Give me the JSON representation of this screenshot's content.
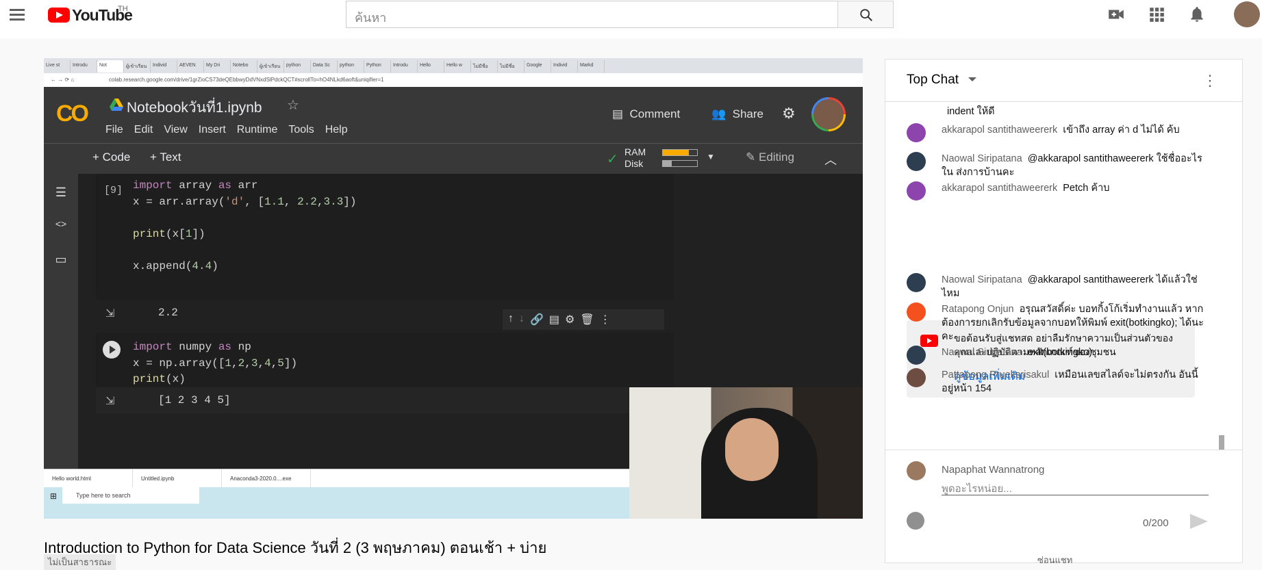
{
  "masthead": {
    "logo_text": "YouTube",
    "country_code": "TH",
    "search_placeholder": "ค้นหา"
  },
  "browser": {
    "tabs": [
      "Live st",
      "Introdu",
      "Not",
      "ผู้เข้าเรียน",
      "Individ",
      "AEVEN",
      "My Dri",
      "Notebo",
      "ผู้เข้าเรียน",
      "python",
      "Data Sc",
      "python",
      "Python",
      "Introdu",
      "Hello",
      "Hello w",
      "ไม่มีชื่อ",
      "ไม่มีชื่อ",
      "Google",
      "Individ",
      "Markd"
    ],
    "url": "colab.research.google.com/drive/1grZioCS73deQEbbwyDdVNxdSlPdckQCT#scrollTo=hO4NLkd6aoft&uniqifier=1"
  },
  "colab": {
    "logo": "CO",
    "notebook_title": "Notebookวันที่1.ipynb",
    "menu": [
      "File",
      "Edit",
      "View",
      "Insert",
      "Runtime",
      "Tools",
      "Help"
    ],
    "comment_label": "Comment",
    "share_label": "Share",
    "add_code": "+ Code",
    "add_text": "+ Text",
    "ram_label": "RAM",
    "disk_label": "Disk",
    "ram_fill": 0.75,
    "disk_fill": 0.25,
    "editing_label": "Editing",
    "cell1": {
      "exec": "[9]",
      "lines": [
        "import array as arr",
        "x = arr.array('d', [1.1, 2.2,3.3])",
        "",
        "print(x[1])",
        "",
        "x.append(4.4)"
      ],
      "output": "2.2"
    },
    "cell2": {
      "lines": [
        "import numpy as np",
        "x = np.array([1,2,3,4,5])",
        "print(x)"
      ],
      "output": "[1 2 3 4 5]"
    }
  },
  "windows": {
    "downloads": [
      "Hello world.html",
      "Untitled.ipynb",
      "Anaconda3-2020.0....exe"
    ],
    "search_placeholder": "Type here to search"
  },
  "video": {
    "title": "Introduction to Python for Data Science วันที่ 2 (3 พฤษภาคม) ตอนเช้า + บ่าย",
    "tag": "ไม่เป็นสาธารณะ"
  },
  "chat": {
    "title": "Top Chat",
    "messages": [
      {
        "author": "",
        "text": "indent ให้ดี",
        "color": "#ffffff"
      },
      {
        "author": "akkarapol santithaweererk",
        "text": "เข้าถึง array ค่า d ไม่ได้ ค้บ",
        "color": "#8e44ad"
      },
      {
        "author": "Naowal Siripatana",
        "text": "@akkarapol santithaweererk ใช้ชื่ออะไรใน ส่งการบ้านคะ",
        "color": "#2c3e50"
      },
      {
        "author": "akkarapol santithaweererk",
        "text": "Petch ค้าบ",
        "color": "#8e44ad"
      },
      {
        "author": "Naowal Siripatana",
        "text": "@akkarapol santithaweererk ได้แล้วใช่ไหม",
        "color": "#2c3e50"
      },
      {
        "author": "Ratapong Onjun",
        "text": "อรุณสวัสดิ์ค่ะ บอทกิ้งโก้เริ่มทำงานแล้ว หากต้องการยกเลิกรับข้อมูลจากบอทให้พิมพ์ exit(botkingko); ได้นะคะ",
        "color": "#f4511e"
      },
      {
        "author": "Naowal Siripatana",
        "text": "exit(botkingko)",
        "color": "#2c3e50"
      },
      {
        "author": "Pattapong Prueksrisakul",
        "text": "เหมือนเลขสไลด์จะไม่ตรงกัน อันนี้อยู่หน้า 154",
        "color": "#6d4c41"
      }
    ],
    "banner": {
      "text": "ขอต้อนรับสู่แชทสด อย่าลืมรักษาความเป็นส่วนตัวของคุณและปฏิบัติตามหลักเกณฑ์ของชุมชน",
      "link": "ดูข้อมูลเพิ่มเติม"
    },
    "me": {
      "name": "Napaphat Wannatrong",
      "placeholder": "พูดอะไรหน่อย..."
    },
    "counter": "0/200",
    "hide_label": "ซ่อนแชท"
  }
}
